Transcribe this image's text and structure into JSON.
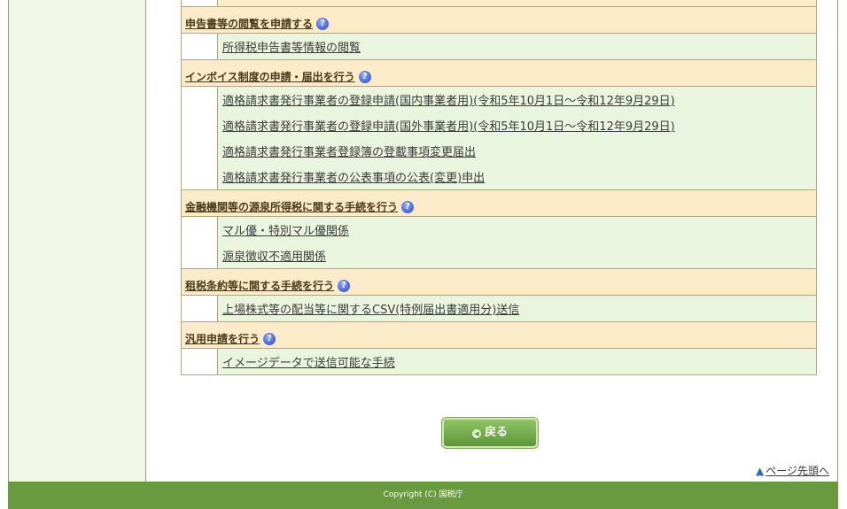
{
  "sections": [
    {
      "title": "申告書等の閲覧を申請する",
      "links": [
        "所得税申告書等情報の閲覧"
      ]
    },
    {
      "title": "インボイス制度の申請・届出を行う",
      "links": [
        "適格請求書発行事業者の登録申請(国内事業者用)(令和5年10月1日～令和12年9月29日)",
        "適格請求書発行事業者の登録申請(国外事業者用)(令和5年10月1日～令和12年9月29日)",
        "適格請求書発行事業者登録簿の登載事項変更届出",
        "適格請求書発行事業者の公表事項の公表(変更)申出"
      ]
    },
    {
      "title": "金融機関等の源泉所得税に関する手続を行う",
      "links": [
        "マル優・特別マル優関係",
        "源泉徴収不適用関係"
      ]
    },
    {
      "title": "租税条約等に関する手続を行う",
      "links": [
        "上場株式等の配当等に関するCSV(特例届出書適用分)送信"
      ]
    },
    {
      "title": "汎用申請を行う",
      "links": [
        "イメージデータで送信可能な手続"
      ]
    }
  ],
  "help_icon_glyph": "?",
  "back_button": {
    "label": "戻る"
  },
  "page_top": {
    "label": "ページ先頭へ"
  },
  "footer": {
    "copyright": "Copyright (C) 国税庁"
  },
  "colors": {
    "section_header_bg": "#fcebc9",
    "link_area_bg": "#eaf5df",
    "footer_bg": "#6a9a3f",
    "button_green": "#6fa94a"
  }
}
